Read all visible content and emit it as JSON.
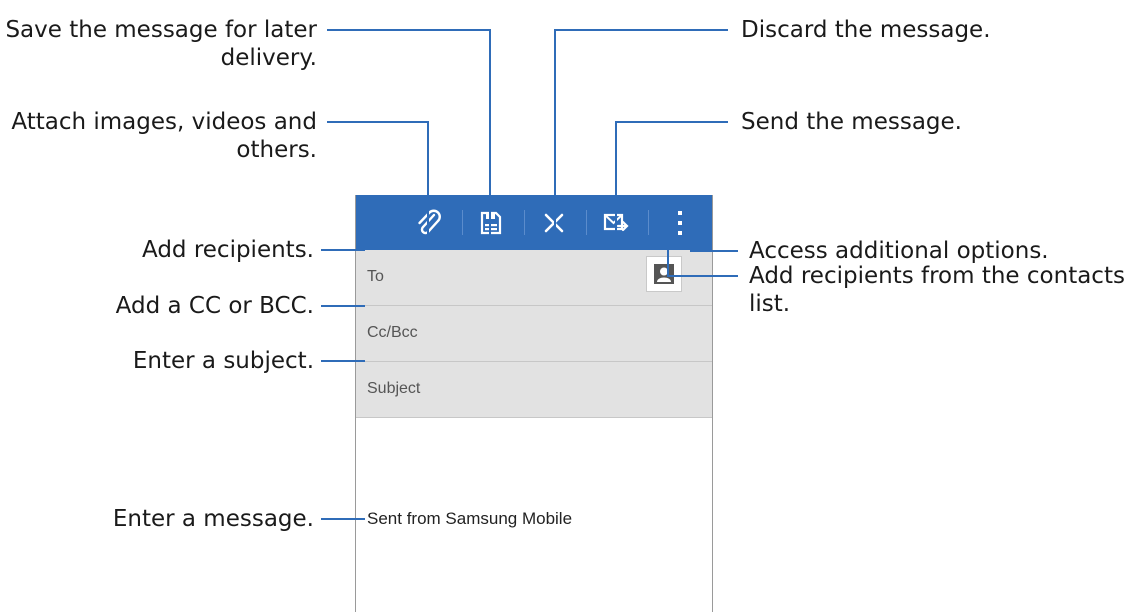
{
  "phone": {
    "fields": {
      "to_label": "To",
      "cc_label": "Cc/Bcc",
      "subject_label": "Subject"
    },
    "body_text": "Sent from Samsung Mobile",
    "toolbar_icons": [
      "attach-icon",
      "save-icon",
      "discard-icon",
      "send-icon",
      "more-options-icon"
    ],
    "colors": {
      "toolbar": "#2f6cb8",
      "field_bg": "#e2e2e2"
    }
  },
  "callouts": {
    "save_line1": "Save the message for later",
    "save_line2": "delivery.",
    "attach_line1": "Attach images, videos and",
    "attach_line2": "others.",
    "add_recipients": "Add recipients.",
    "add_cc": "Add a CC or BCC.",
    "enter_subject": "Enter a subject.",
    "enter_message": "Enter a message.",
    "discard": "Discard the message.",
    "send": "Send the message.",
    "more_options": "Access additional options.",
    "contacts_line1": "Add recipients from the contacts",
    "contacts_line2": "list."
  }
}
